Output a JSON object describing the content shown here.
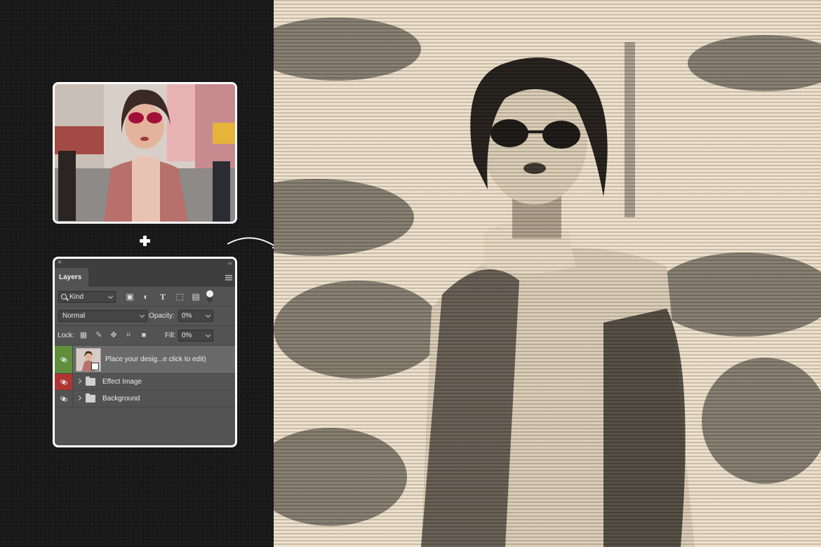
{
  "panel": {
    "tab_label": "Layers",
    "close_glyph": "×",
    "collapse_glyph": "‹‹",
    "filter_kind": "Kind",
    "blend_mode": "Normal",
    "opacity_label": "Opacity:",
    "opacity_value": "0%",
    "lock_label": "Lock:",
    "fill_label": "Fill:",
    "fill_value": "0%",
    "layers": [
      {
        "name": "Place your desig...e click to edit)",
        "eye_color": "#5f8f3a",
        "kind": "smart-object"
      },
      {
        "name": "Effect Image",
        "eye_color": "#b03434",
        "kind": "group"
      },
      {
        "name": "Background",
        "eye_color": "#535353",
        "kind": "group"
      }
    ]
  },
  "icons": {
    "filter_icons": [
      "image-filter-icon",
      "adjustment-filter-icon",
      "type-filter-icon",
      "shape-filter-icon",
      "smart-object-filter-icon"
    ],
    "lock_icons": [
      "lock-transparent-icon",
      "lock-paint-icon",
      "lock-position-icon",
      "lock-artboard-icon",
      "lock-all-icon"
    ]
  },
  "colors": {
    "background": "#161616",
    "panel": "#535353",
    "paper": "#ece0cb",
    "ink": "#1c1916"
  }
}
